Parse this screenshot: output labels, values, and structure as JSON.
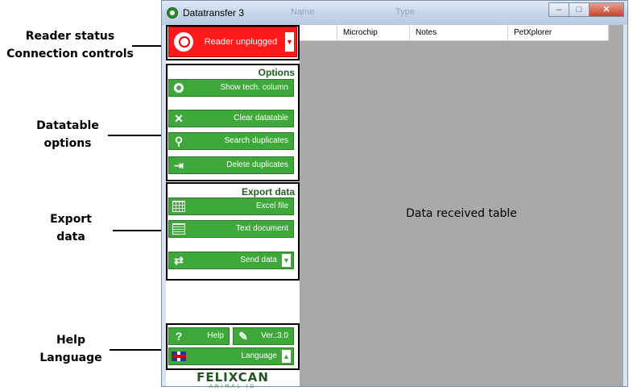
{
  "annotations": {
    "reader_status": "Reader status",
    "connection_controls": "Connection controls",
    "datatable_1": "Datatable",
    "datatable_2": "options",
    "export_1": "Export",
    "export_2": "data",
    "help_1": "Help",
    "help_2": "Language"
  },
  "window": {
    "title": "Datatransfer 3",
    "ghost_name": "Name",
    "ghost_type": "Type",
    "minimize_icon": "minimize-icon",
    "maximize_icon": "maximize-icon",
    "close_icon": "close-icon"
  },
  "reader": {
    "label": "Reader unplugged",
    "status_color": "#ff1a1a",
    "dropdown": "▼"
  },
  "options": {
    "title": "Options",
    "buttons": [
      {
        "label": "Show tech. column",
        "icon": "ring-icon"
      },
      {
        "label": "Clear datatable",
        "icon": "clear-x-icon"
      },
      {
        "label": "Search duplicates",
        "icon": "magnifier-icon"
      },
      {
        "label": "Delete duplicates",
        "icon": "delete-duplicates-icon"
      }
    ]
  },
  "export": {
    "title": "Export data",
    "buttons": [
      {
        "label": "Excel file",
        "icon": "excel-icon"
      },
      {
        "label": "Text document",
        "icon": "text-document-icon"
      },
      {
        "label": "Send data",
        "icon": "send-arrows-icon",
        "dropdown": "▼"
      }
    ]
  },
  "help": {
    "help_label": "Help",
    "help_icon_text": "?",
    "version_label": "Ver.:3.0",
    "language_label": "Language",
    "language_dropdown": "▲"
  },
  "logo": {
    "main": "FELIXCAN",
    "sub": "ANIMAL ID"
  },
  "table": {
    "columns": [
      "",
      "Microchip",
      "Notes",
      "PetXplorer"
    ],
    "label": "Data received table"
  },
  "colors": {
    "accent_green": "#3ea83a",
    "status_red": "#ff1a1a",
    "table_bg": "#a9a9a9"
  }
}
